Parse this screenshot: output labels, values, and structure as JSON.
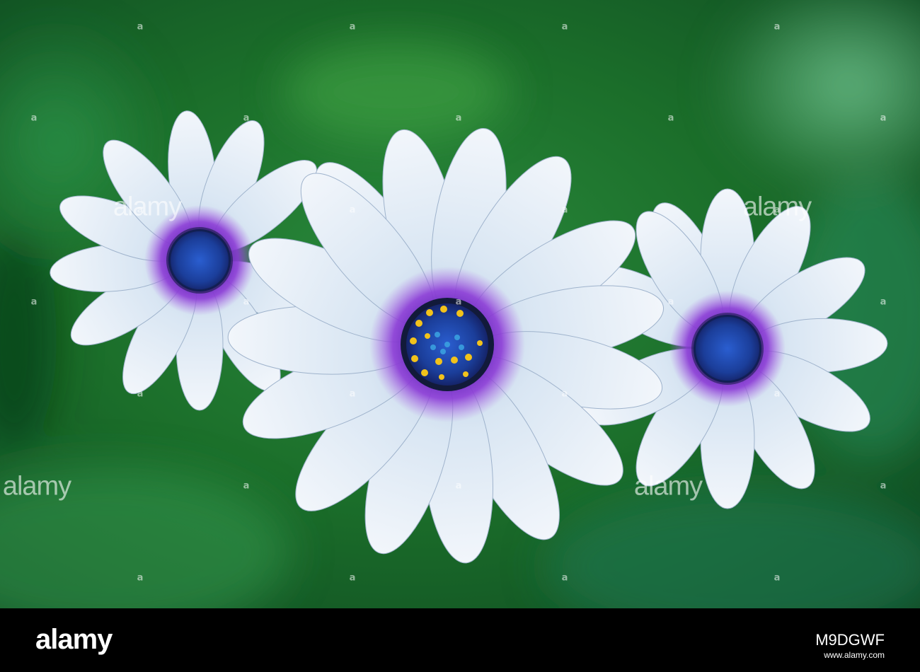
{
  "scene": {
    "subject": "three white-blue daisies with purple centers",
    "background_color": "#1f7a2e",
    "petal_color": "#dde8f4",
    "center_color": "#1e3f9a",
    "ring_color": "#7a2fc4"
  },
  "watermark": {
    "letter": "a",
    "word": "alamy"
  },
  "footer": {
    "logo": "alamy",
    "image_code": "M9DGWF",
    "site": "www.alamy.com"
  }
}
